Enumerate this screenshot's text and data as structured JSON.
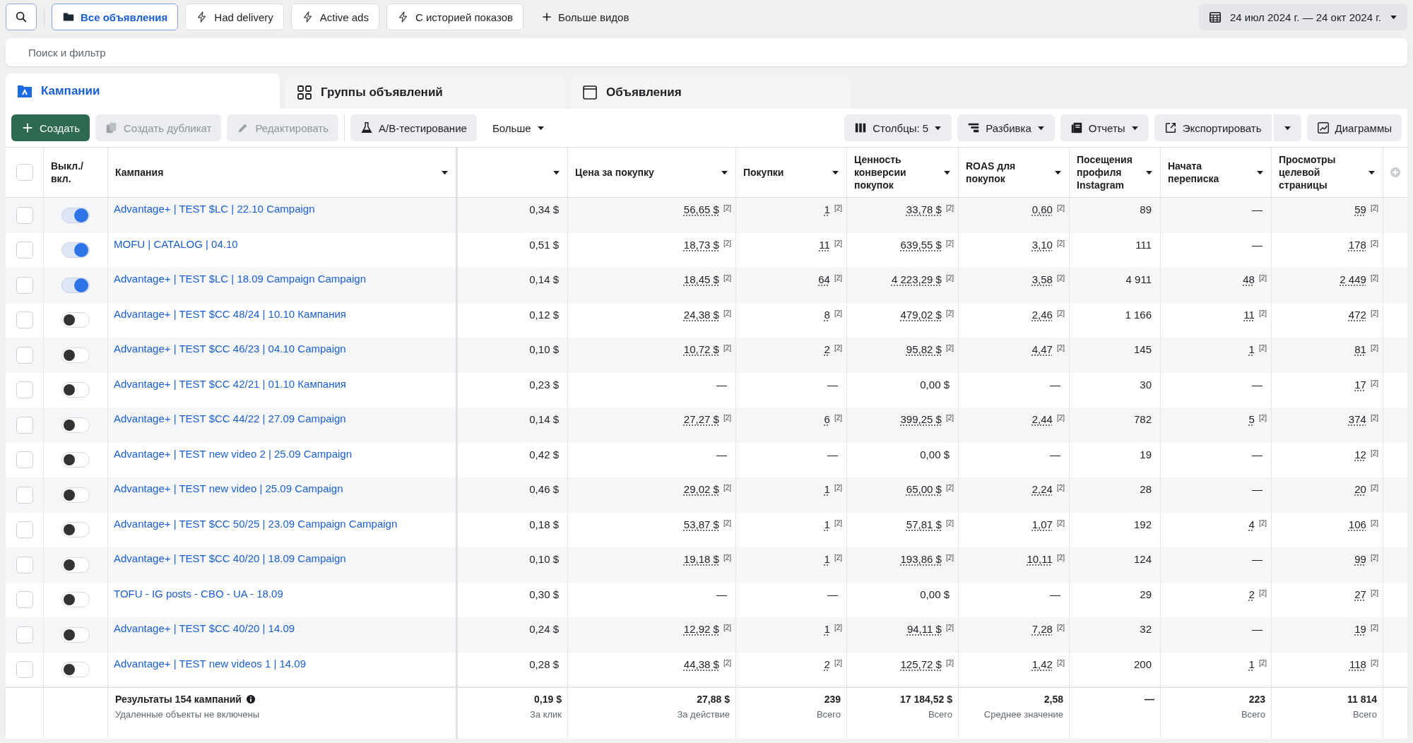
{
  "views": [
    {
      "label": "Все объявления",
      "selected": true,
      "kind": "folder"
    },
    {
      "label": "Had delivery",
      "selected": false,
      "kind": "bolt"
    },
    {
      "label": "Active ads",
      "selected": false,
      "kind": "bolt"
    },
    {
      "label": "С историей показов",
      "selected": false,
      "kind": "bolt"
    }
  ],
  "more_views": "Больше видов",
  "date_range": "24 июл 2024 г. — 24 окт 2024 г.",
  "search": {
    "placeholder": "Поиск и фильтр"
  },
  "level_tabs": [
    {
      "label": "Кампании",
      "selected": true,
      "kind": "campaign"
    },
    {
      "label": "Группы объявлений",
      "selected": false,
      "kind": "adset"
    },
    {
      "label": "Объявления",
      "selected": false,
      "kind": "ad"
    }
  ],
  "toolbar_left": [
    {
      "label": "Создать",
      "kind": "create",
      "disabled": false,
      "caret": false
    },
    {
      "label": "Создать дубликат",
      "kind": "duplicate",
      "disabled": true,
      "caret": false
    },
    {
      "label": "Редактировать",
      "kind": "edit",
      "disabled": true,
      "caret": false
    },
    {
      "label": "A/B-тестирование",
      "kind": "abtest",
      "disabled": false,
      "caret": false
    },
    {
      "label": "Больше",
      "kind": "more",
      "disabled": false,
      "caret": true
    }
  ],
  "toolbar_right": [
    {
      "label": "Столбцы: 5",
      "kind": "columns",
      "caret": true,
      "split": false
    },
    {
      "label": "Разбивка",
      "kind": "breakdown",
      "caret": true,
      "split": false
    },
    {
      "label": "Отчеты",
      "kind": "reports",
      "caret": true,
      "split": false
    },
    {
      "label": "Экспортировать",
      "kind": "export",
      "caret": false,
      "split": true
    },
    {
      "label": "Диаграммы",
      "kind": "charts",
      "caret": false,
      "split": false
    }
  ],
  "table": {
    "select_all": {
      "checked": false
    },
    "columns": [
      {
        "label": "Выкл./вкл.",
        "sortable": false
      },
      {
        "label": "Кампания",
        "sortable": true
      },
      {
        "sortable": true
      },
      {
        "label": "Цена за покупку",
        "sortable": true
      },
      {
        "label": "Покупки",
        "sortable": true
      },
      {
        "label": "Ценность конверсии покупок",
        "sortable": true
      },
      {
        "label": "ROAS для покупок",
        "sortable": true
      },
      {
        "label": "Посещения профиля Instagram",
        "sortable": true
      },
      {
        "label": "Начата переписка",
        "sortable": true
      },
      {
        "label": "Просмотры целевой страницы",
        "sortable": true
      }
    ],
    "rows": [
      {
        "selected": false,
        "on": true,
        "name": "Advantage+ | TEST $LC | 22.10 Campaign",
        "cells": [
          {
            "value": "0,34 $"
          },
          {
            "value": "56,65 $",
            "note": "[2]"
          },
          {
            "value": "1",
            "note": "[2]"
          },
          {
            "value": "33,78 $",
            "note": "[2]"
          },
          {
            "value": "0,60",
            "note": "[2]"
          },
          {
            "value": "89"
          },
          {
            "value": "—"
          },
          {
            "value": "59",
            "note": "[2]"
          }
        ]
      },
      {
        "selected": false,
        "on": true,
        "name": "MOFU | CATALOG | 04.10",
        "cells": [
          {
            "value": "0,51 $"
          },
          {
            "value": "18,73 $",
            "note": "[2]"
          },
          {
            "value": "11",
            "note": "[2]"
          },
          {
            "value": "639,55 $",
            "note": "[2]"
          },
          {
            "value": "3,10",
            "note": "[2]"
          },
          {
            "value": "111"
          },
          {
            "value": "—"
          },
          {
            "value": "178",
            "note": "[2]"
          }
        ]
      },
      {
        "selected": false,
        "on": true,
        "name": "Advantage+ | TEST $LC | 18.09 Campaign Campaign",
        "cells": [
          {
            "value": "0,14 $"
          },
          {
            "value": "18,45 $",
            "note": "[2]"
          },
          {
            "value": "64",
            "note": "[2]"
          },
          {
            "value": "4 223,29 $",
            "note": "[2]"
          },
          {
            "value": "3,58",
            "note": "[2]"
          },
          {
            "value": "4 911"
          },
          {
            "value": "48",
            "note": "[2]"
          },
          {
            "value": "2 449",
            "note": "[2]"
          }
        ]
      },
      {
        "selected": false,
        "on": false,
        "name": "Advantage+ | TEST $CC 48/24 | 10.10 Кампания",
        "cells": [
          {
            "value": "0,12 $"
          },
          {
            "value": "24,38 $",
            "note": "[2]"
          },
          {
            "value": "8",
            "note": "[2]"
          },
          {
            "value": "479,02 $",
            "note": "[2]"
          },
          {
            "value": "2,46",
            "note": "[2]"
          },
          {
            "value": "1 166"
          },
          {
            "value": "11",
            "note": "[2]"
          },
          {
            "value": "472",
            "note": "[2]"
          }
        ]
      },
      {
        "selected": false,
        "on": false,
        "name": "Advantage+ | TEST $CC 46/23 | 04.10 Campaign",
        "cells": [
          {
            "value": "0,10 $"
          },
          {
            "value": "10,72 $",
            "note": "[2]"
          },
          {
            "value": "2",
            "note": "[2]"
          },
          {
            "value": "95,82 $",
            "note": "[2]"
          },
          {
            "value": "4,47",
            "note": "[2]"
          },
          {
            "value": "145"
          },
          {
            "value": "1",
            "note": "[2]"
          },
          {
            "value": "81",
            "note": "[2]"
          }
        ]
      },
      {
        "selected": false,
        "on": false,
        "name": "Advantage+ | TEST $CC 42/21 | 01.10 Кампания",
        "cells": [
          {
            "value": "0,23 $"
          },
          {
            "value": "—"
          },
          {
            "value": "—"
          },
          {
            "value": "0,00 $"
          },
          {
            "value": "—"
          },
          {
            "value": "30"
          },
          {
            "value": "—"
          },
          {
            "value": "17",
            "note": "[2]"
          }
        ]
      },
      {
        "selected": false,
        "on": false,
        "name": "Advantage+ | TEST $CC 44/22 | 27.09 Campaign",
        "cells": [
          {
            "value": "0,14 $"
          },
          {
            "value": "27,27 $",
            "note": "[2]"
          },
          {
            "value": "6",
            "note": "[2]"
          },
          {
            "value": "399,25 $",
            "note": "[2]"
          },
          {
            "value": "2,44",
            "note": "[2]"
          },
          {
            "value": "782"
          },
          {
            "value": "5",
            "note": "[2]"
          },
          {
            "value": "374",
            "note": "[2]"
          }
        ]
      },
      {
        "selected": false,
        "on": false,
        "name": "Advantage+ | TEST new video 2 | 25.09 Campaign",
        "cells": [
          {
            "value": "0,42 $"
          },
          {
            "value": "—"
          },
          {
            "value": "—"
          },
          {
            "value": "0,00 $"
          },
          {
            "value": "—"
          },
          {
            "value": "19"
          },
          {
            "value": "—"
          },
          {
            "value": "12",
            "note": "[2]"
          }
        ]
      },
      {
        "selected": false,
        "on": false,
        "name": "Advantage+ | TEST new video | 25.09 Campaign",
        "cells": [
          {
            "value": "0,46 $"
          },
          {
            "value": "29,02 $",
            "note": "[2]"
          },
          {
            "value": "1",
            "note": "[2]"
          },
          {
            "value": "65,00 $",
            "note": "[2]"
          },
          {
            "value": "2,24",
            "note": "[2]"
          },
          {
            "value": "28"
          },
          {
            "value": "—"
          },
          {
            "value": "20",
            "note": "[2]"
          }
        ]
      },
      {
        "selected": false,
        "on": false,
        "name": "Advantage+ | TEST $CC 50/25 | 23.09 Campaign Campaign",
        "cells": [
          {
            "value": "0,18 $"
          },
          {
            "value": "53,87 $",
            "note": "[2]"
          },
          {
            "value": "1",
            "note": "[2]"
          },
          {
            "value": "57,81 $",
            "note": "[2]"
          },
          {
            "value": "1,07",
            "note": "[2]"
          },
          {
            "value": "192"
          },
          {
            "value": "4",
            "note": "[2]"
          },
          {
            "value": "106",
            "note": "[2]"
          }
        ]
      },
      {
        "selected": false,
        "on": false,
        "name": "Advantage+ | TEST $CC 40/20 | 18.09 Campaign",
        "cells": [
          {
            "value": "0,10 $"
          },
          {
            "value": "19,18 $",
            "note": "[2]"
          },
          {
            "value": "1",
            "note": "[2]"
          },
          {
            "value": "193,86 $",
            "note": "[2]"
          },
          {
            "value": "10,11",
            "note": "[2]"
          },
          {
            "value": "124"
          },
          {
            "value": "—"
          },
          {
            "value": "99",
            "note": "[2]"
          }
        ]
      },
      {
        "selected": false,
        "on": false,
        "name": "TOFU - IG posts - CBO - UA - 18.09",
        "cells": [
          {
            "value": "0,30 $"
          },
          {
            "value": "—"
          },
          {
            "value": "—"
          },
          {
            "value": "0,00 $"
          },
          {
            "value": "—"
          },
          {
            "value": "29"
          },
          {
            "value": "2",
            "note": "[2]"
          },
          {
            "value": "27",
            "note": "[2]"
          }
        ]
      },
      {
        "selected": false,
        "on": false,
        "name": "Advantage+ | TEST $CC 40/20 | 14.09",
        "cells": [
          {
            "value": "0,24 $"
          },
          {
            "value": "12,92 $",
            "note": "[2]"
          },
          {
            "value": "1",
            "note": "[2]"
          },
          {
            "value": "94,11 $",
            "note": "[2]"
          },
          {
            "value": "7,28",
            "note": "[2]"
          },
          {
            "value": "32"
          },
          {
            "value": "—"
          },
          {
            "value": "19",
            "note": "[2]"
          }
        ]
      },
      {
        "selected": false,
        "on": false,
        "name": "Advantage+ | TEST new videos 1 | 14.09",
        "cells": [
          {
            "value": "0,28 $"
          },
          {
            "value": "44,38 $",
            "note": "[2]"
          },
          {
            "value": "2",
            "note": "[2]"
          },
          {
            "value": "125,72 $",
            "note": "[2]"
          },
          {
            "value": "1,42",
            "note": "[2]"
          },
          {
            "value": "200"
          },
          {
            "value": "1",
            "note": "[2]"
          },
          {
            "value": "118",
            "note": "[2]"
          }
        ]
      }
    ],
    "footer": {
      "title": "Результаты 154 кампаний",
      "subtitle": "Удаленные объекты не включены",
      "totals": [
        {
          "value": "0,19 $",
          "caption": "За клик"
        },
        {
          "value": "27,88 $",
          "caption": "За действие"
        },
        {
          "value": "239",
          "caption": "Всего"
        },
        {
          "value": "17 184,52 $",
          "caption": "Всего"
        },
        {
          "value": "2,58",
          "caption": "Среднее значение"
        },
        {
          "value": "—"
        },
        {
          "value": "223",
          "caption": "Всего"
        },
        {
          "value": "11 814",
          "caption": "Всего"
        }
      ]
    }
  }
}
